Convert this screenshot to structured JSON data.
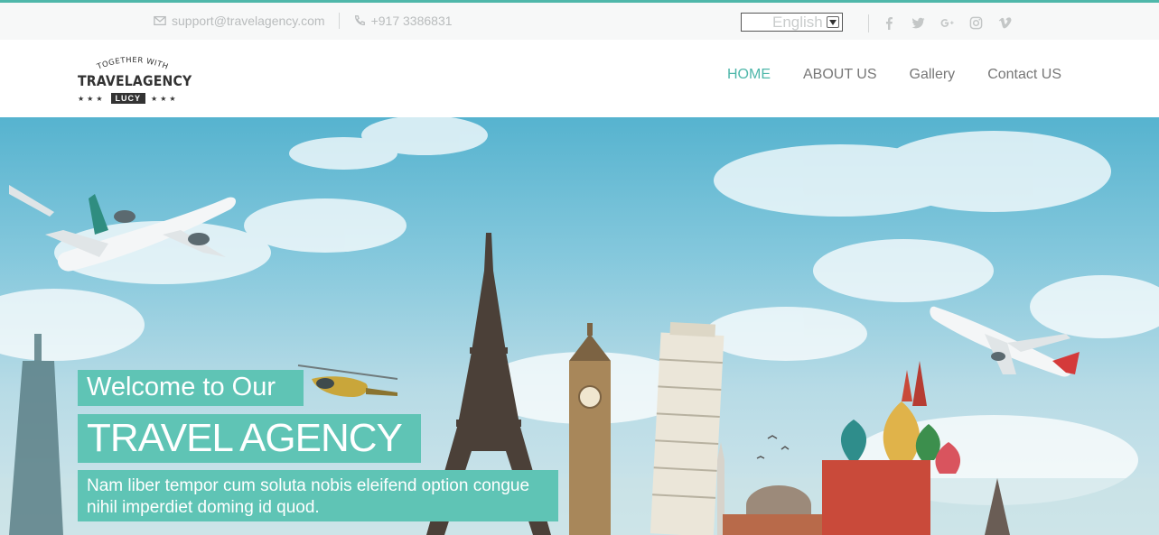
{
  "topbar": {
    "email": "support@travelagency.com",
    "phone": "+917 3386831",
    "language": "English",
    "social": [
      "facebook-icon",
      "twitter-icon",
      "google-plus-icon",
      "instagram-icon",
      "vimeo-icon"
    ]
  },
  "logo": {
    "arc_text": "TOGETHER WITH",
    "main_text": "TRAVELAGENCY",
    "tag_text": "LUCY",
    "stars": "★★★"
  },
  "nav": {
    "items": [
      "HOME",
      "ABOUT US",
      "Gallery",
      "Contact US"
    ],
    "active": "HOME"
  },
  "hero": {
    "line1": "Welcome to Our",
    "line2": "TRAVEL AGENCY",
    "line3": "Nam liber tempor cum soluta nobis eleifend option congue nihil imperdiet doming id quod."
  },
  "colors": {
    "accent": "#4fb7aa",
    "caption_bg": "#5fc4b5",
    "muted_text": "#b9bcbd"
  }
}
